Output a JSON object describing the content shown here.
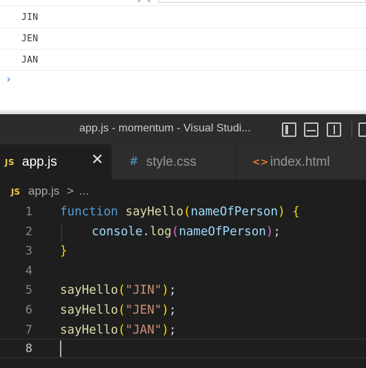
{
  "console": {
    "log_lines": [
      "JIN",
      "JEN",
      "JAN"
    ],
    "prompt_symbol": "›"
  },
  "window": {
    "title": "app.js - momentum - Visual Studi..."
  },
  "tabs": [
    {
      "icon": "JS",
      "label": "app.js",
      "active": true,
      "close": "✕"
    },
    {
      "icon": "#",
      "label": "style.css",
      "active": false
    },
    {
      "icon": "<>",
      "label": "index.html",
      "active": false
    }
  ],
  "breadcrumb": {
    "icon": "JS",
    "file": "app.js",
    "separator": ">",
    "more": "..."
  },
  "editor": {
    "line_numbers": [
      "1",
      "2",
      "3",
      "4",
      "5",
      "6",
      "7",
      "8"
    ],
    "active_line": "8",
    "line1": {
      "keyword": "function",
      "name": "sayHello",
      "paren_open": "(",
      "param": "nameOfPerson",
      "paren_close": ")",
      "brace": "{"
    },
    "line2": {
      "object": "console",
      "dot": ".",
      "method": "log",
      "paren_open": "(",
      "arg": "nameOfPerson",
      "paren_close": ")",
      "semi": ";"
    },
    "line3": {
      "brace": "}"
    },
    "calls": [
      {
        "fn": "sayHello",
        "open": "(",
        "arg": "\"JIN\"",
        "close": ")",
        "semi": ";"
      },
      {
        "fn": "sayHello",
        "open": "(",
        "arg": "\"JEN\"",
        "close": ")",
        "semi": ";"
      },
      {
        "fn": "sayHello",
        "open": "(",
        "arg": "\"JAN\"",
        "close": ")",
        "semi": ";"
      }
    ]
  },
  "colors": {
    "keyword": "#569cd6",
    "function": "#dcdcaa",
    "parameter": "#9cdcfe",
    "string": "#ce9178",
    "bracket_level1": "#ffd700",
    "bracket_level2": "#da70d6"
  }
}
